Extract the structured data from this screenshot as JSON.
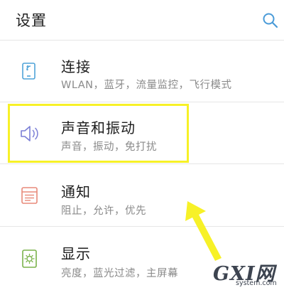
{
  "header": {
    "title": "设置",
    "search_icon": "search-icon"
  },
  "settings": [
    {
      "title": "连接",
      "subtitle": "WLAN，蓝牙，流量监控，飞行模式",
      "icon": "connection-icon",
      "icon_color": "#4fa3d8"
    },
    {
      "title": "声音和振动",
      "subtitle": "声音，振动，免打扰",
      "icon": "speaker-icon",
      "icon_color": "#7b7fd6"
    },
    {
      "title": "通知",
      "subtitle": "阻止，允许，优先",
      "icon": "notification-icon",
      "icon_color": "#e88a7a"
    },
    {
      "title": "显示",
      "subtitle": "亮度，蓝光过滤，主屏幕",
      "icon": "display-icon",
      "icon_color": "#7ab24a"
    }
  ],
  "watermark": {
    "logo_text": "GXI网",
    "url": "system.com"
  },
  "colors": {
    "highlight": "#f7f127",
    "arrow": "#f7f127",
    "search": "#4a9bd8"
  }
}
